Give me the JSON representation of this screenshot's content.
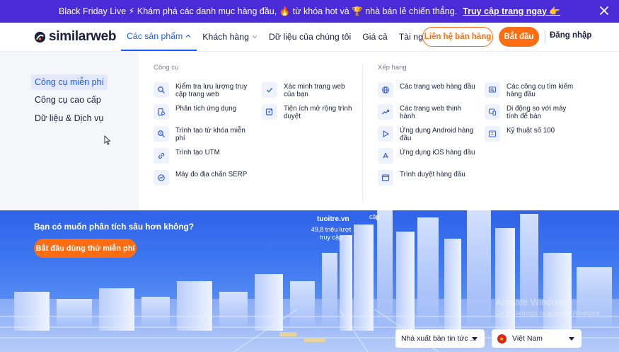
{
  "banner": {
    "text": "Black Friday Live ⚡ Khám phá các danh mục hàng đầu, 🔥 từ khóa hot và 🏆 nhà bán lẻ chiến thắng.",
    "link": "Truy cập trang ngay 👉"
  },
  "header": {
    "logo_text": "similarweb",
    "nav": [
      {
        "label": "Các sản phẩm"
      },
      {
        "label": "Khách hàng"
      },
      {
        "label": "Dữ liệu của chúng tôi"
      },
      {
        "label": "Giá cả"
      },
      {
        "label": "Tài nguyên"
      }
    ],
    "contact_label": "Liên hệ bán hàng",
    "start_label": "Bắt đầu",
    "login_label": "Đăng nhập"
  },
  "menu": {
    "left": [
      {
        "label": "Công cụ miễn phí"
      },
      {
        "label": "Công cụ cao cấp"
      },
      {
        "label": "Dữ liệu & Dịch vụ"
      }
    ],
    "tools_title": "Công cụ",
    "ranking_title": "Xếp hạng",
    "tools_col1": [
      {
        "label": "Kiểm tra lưu lượng truy cập trang web"
      },
      {
        "label": "Phân tích ứng dụng"
      },
      {
        "label": "Trình tạo từ khóa miễn phí"
      },
      {
        "label": "Trình tạo UTM"
      },
      {
        "label": "Máy đo địa chấn SERP"
      }
    ],
    "tools_col2": [
      {
        "label": "Xác minh trang web của bạn"
      },
      {
        "label": "Tiện ích mở rộng trình duyệt"
      }
    ],
    "rank_col1": [
      {
        "label": "Các trang web hàng đầu"
      },
      {
        "label": "Các trang web thịnh hành"
      },
      {
        "label": "Ứng dụng Android hàng đầu"
      },
      {
        "label": "Ứng dụng iOS hàng đầu"
      },
      {
        "label": "Trình duyệt hàng đầu"
      }
    ],
    "rank_col2": [
      {
        "label": "Các công cụ tìm kiếm hàng đầu"
      },
      {
        "label": "Di động so với máy tính để bàn"
      },
      {
        "label": "Kỹ thuật số 100"
      }
    ]
  },
  "hero": {
    "title": "Bạn có muốn phân tích sâu hơn không?",
    "cta": "Bắt đầu dùng thử miễn phí",
    "site_name": "tuoitre.vn",
    "site_visits": "49,8 triệu lượt truy cập",
    "site_2": "cập",
    "publisher_select": "Nhà xuất bản tin tức ...",
    "country_select": "Việt Nam",
    "watermark_1": "Activate Windows",
    "watermark_2": "Go to Settings to activate Windows."
  },
  "colors": {
    "accent_blue": "#195afe",
    "orange": "#ff6d12",
    "banner_purple": "#4a2bd8"
  }
}
